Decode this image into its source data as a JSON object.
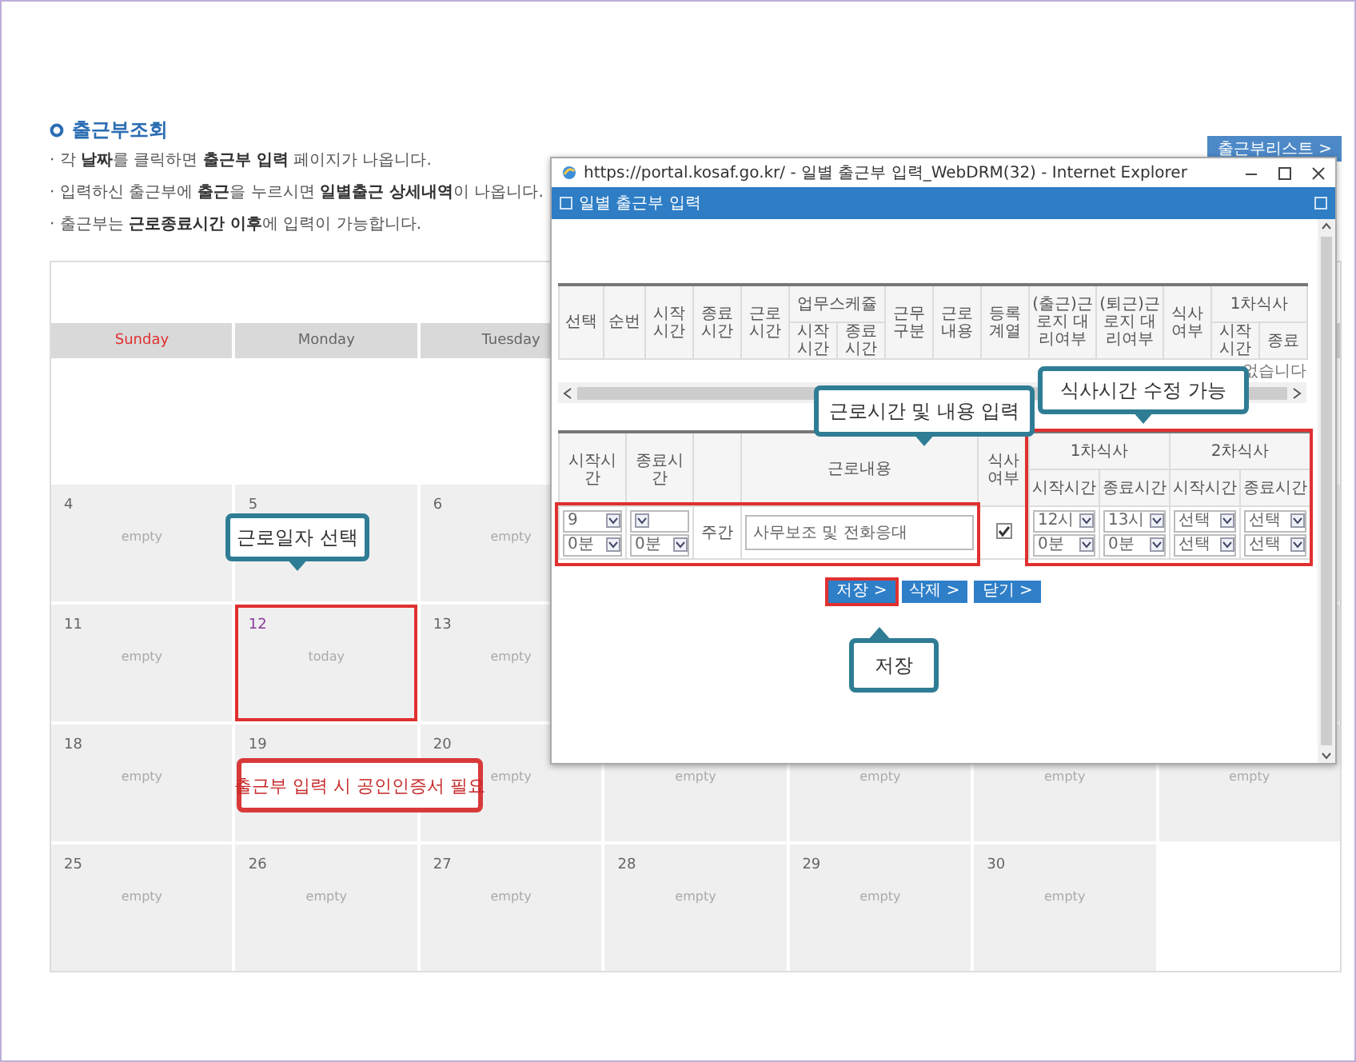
{
  "page": {
    "title": "출근부조회",
    "list_button": "출근부리스트 >",
    "notes": [
      "· 각 **날짜**를 클릭하면 **출근부 입력** 페이지가 나옵니다.",
      "· 입력하신 출근부에 **출근**을 누르시면 **일별출근 상세내역**이 나옵니다.",
      "· 출근부는 **근로종료시간 이후**에 입력이 가능합니다."
    ]
  },
  "calendar": {
    "weekdays": [
      {
        "label": "Sunday",
        "holiday": true
      },
      {
        "label": "Monday",
        "holiday": false
      },
      {
        "label": "Tuesday",
        "holiday": false
      }
    ],
    "weeks": [
      [
        {
          "kind": "blank"
        },
        {
          "kind": "blank"
        },
        {
          "kind": "blank"
        },
        {
          "kind": "blank"
        },
        {
          "kind": "blank"
        },
        {
          "kind": "blank"
        },
        {
          "kind": "blank"
        }
      ],
      [
        {
          "kind": "day",
          "date": "4",
          "note": "empty"
        },
        {
          "kind": "day",
          "date": "5"
        },
        {
          "kind": "day",
          "date": "6",
          "note": "empty"
        },
        {
          "kind": "day"
        },
        {
          "kind": "day"
        },
        {
          "kind": "day"
        },
        {
          "kind": "day"
        }
      ],
      [
        {
          "kind": "day",
          "date": "11",
          "note": "empty"
        },
        {
          "kind": "day",
          "date": "12",
          "note": "today",
          "today": true,
          "highlighted": true
        },
        {
          "kind": "day",
          "date": "13",
          "note": "empty"
        },
        {
          "kind": "day"
        },
        {
          "kind": "day"
        },
        {
          "kind": "day"
        },
        {
          "kind": "day"
        }
      ],
      [
        {
          "kind": "day",
          "date": "18",
          "note": "empty"
        },
        {
          "kind": "day",
          "date": "19"
        },
        {
          "kind": "day",
          "date": "20",
          "note": "empty"
        },
        {
          "kind": "day",
          "note": "empty"
        },
        {
          "kind": "day",
          "note": "empty"
        },
        {
          "kind": "day",
          "note": "empty"
        },
        {
          "kind": "day",
          "note": "empty"
        }
      ],
      [
        {
          "kind": "day",
          "date": "25",
          "note": "empty"
        },
        {
          "kind": "day",
          "date": "26",
          "note": "empty"
        },
        {
          "kind": "day",
          "date": "27",
          "note": "empty"
        },
        {
          "kind": "day",
          "date": "28",
          "note": "empty"
        },
        {
          "kind": "day",
          "date": "29",
          "note": "empty"
        },
        {
          "kind": "day",
          "date": "30",
          "note": "empty"
        },
        {
          "kind": "blank"
        }
      ]
    ]
  },
  "popup": {
    "title": "https://portal.kosaf.go.kr/ - 일별 출근부 입력_WebDRM(32) - Internet Explorer",
    "header": "일별 출근부 입력",
    "list_table": {
      "columns": [
        {
          "label": "선택"
        },
        {
          "label": "순번"
        },
        {
          "label": "시작시간"
        },
        {
          "label": "종료시간"
        },
        {
          "label": "근로시간"
        },
        {
          "label": "업무스케쥴",
          "children": [
            {
              "label": "시작시간"
            },
            {
              "label": "종료시간"
            }
          ]
        },
        {
          "label": "근무구분"
        },
        {
          "label": "근로내용"
        },
        {
          "label": "등록계열"
        },
        {
          "label": "(출근)근로지 대리여부"
        },
        {
          "label": "(퇴근)근로지 대리여부"
        },
        {
          "label": "식사여부"
        },
        {
          "label": "1차식사",
          "children": [
            {
              "label": "시작시간"
            },
            {
              "label": "종료"
            }
          ]
        }
      ],
      "message": "없습니다"
    },
    "entry_table": {
      "columns": [
        {
          "label": "시작시간"
        },
        {
          "label": "종료시간"
        },
        {
          "label": "근로내용"
        },
        {
          "label": "식사여부"
        },
        {
          "label": "1차식사",
          "children": [
            {
              "label": "시작시간"
            },
            {
              "label": "종료시간"
            }
          ]
        },
        {
          "label": "2차식사",
          "children": [
            {
              "label": "시작시간"
            },
            {
              "label": "종료시간"
            }
          ]
        }
      ],
      "row_highlighted": true,
      "meals_highlighted": true,
      "row": {
        "start": {
          "hour": "9",
          "minute": "0분"
        },
        "end": {
          "minute": "0분"
        },
        "shift": "주간",
        "content": "사무보조 및 전화응대",
        "meal": true,
        "meals": [
          {
            "hour": "12시",
            "minute": "0분"
          },
          {
            "hour": "13시",
            "minute": "0분"
          },
          {
            "hour": "선택",
            "minute": "선택"
          },
          {
            "hour": "선택",
            "minute": "선택"
          }
        ]
      }
    },
    "buttons": [
      {
        "label": "저장 >",
        "highlighted": true
      },
      {
        "label": "삭제 >",
        "highlighted": false
      },
      {
        "label": "닫기 >",
        "highlighted": false
      }
    ]
  },
  "callouts": [
    {
      "text": "근로일자 선택",
      "kind": "below"
    },
    {
      "text": "근로시간 및 내용 입력",
      "kind": "below"
    },
    {
      "text": "식사시간 수정 가능",
      "kind": "below"
    },
    {
      "text": "저장",
      "kind": "above"
    },
    {
      "text": "출근부 입력 시 공인인증서 필요",
      "kind": "warning"
    }
  ]
}
